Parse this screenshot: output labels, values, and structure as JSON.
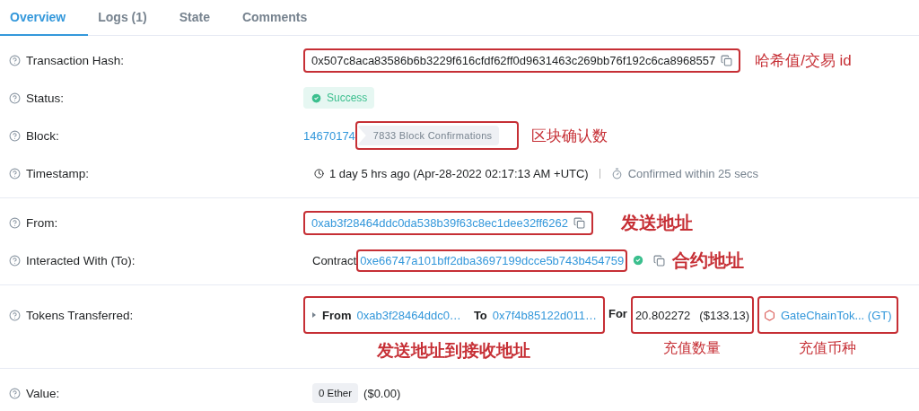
{
  "tabs": [
    {
      "label": "Overview",
      "selected": true
    },
    {
      "label": "Logs (1)",
      "selected": false
    },
    {
      "label": "State",
      "selected": false
    },
    {
      "label": "Comments",
      "selected": false
    }
  ],
  "sections": [
    [
      {
        "kind": "hash",
        "label": "Transaction Hash:",
        "value": "0x507c8aca83586b6b3229f616cfdf62ff0d9631463c269bb76f192c6ca8968557",
        "highlighted": true,
        "note": "哈希值/交易 id"
      },
      {
        "kind": "status",
        "label": "Status:",
        "value": "Success"
      },
      {
        "kind": "block",
        "label": "Block:",
        "value": "14670174",
        "confirmations": "7833 Block Confirmations",
        "highlighted": true,
        "note": "区块确认数"
      },
      {
        "kind": "timestamp",
        "label": "Timestamp:",
        "value": "1 day 5 hrs ago (Apr-28-2022 02:17:13 AM +UTC)",
        "confirmed": "Confirmed within 25 secs"
      }
    ],
    [
      {
        "kind": "address",
        "label": "From:",
        "value": "0xab3f28464ddc0da538b39f63c8ec1dee32ff6262",
        "highlighted": true,
        "note": "发送地址"
      },
      {
        "kind": "contract",
        "label": "Interacted With (To):",
        "prefix": "Contract",
        "value": "0xe66747a101bff2dba3697199dcce5b743b454759",
        "verified": true,
        "highlighted": true,
        "note": "合约地址"
      }
    ],
    [
      {
        "kind": "tokens",
        "label": "Tokens Transferred:",
        "transfer": {
          "from_label": "From",
          "from": "0xab3f28464ddc0…",
          "to_label": "To",
          "to": "0x7f4b85122d011…",
          "highlighted": true,
          "note": "发送地址到接收地址"
        },
        "for_label": "For",
        "amount": {
          "value": "20.802272",
          "usd": "($133.13)",
          "highlighted": true,
          "note": "充值数量"
        },
        "token": {
          "name": "GateChainTok... (GT)",
          "highlighted": true,
          "note": "充值币种"
        }
      }
    ],
    [
      {
        "kind": "value",
        "label": "Value:",
        "value": "0 Ether",
        "usd": "($0.00)"
      }
    ]
  ]
}
